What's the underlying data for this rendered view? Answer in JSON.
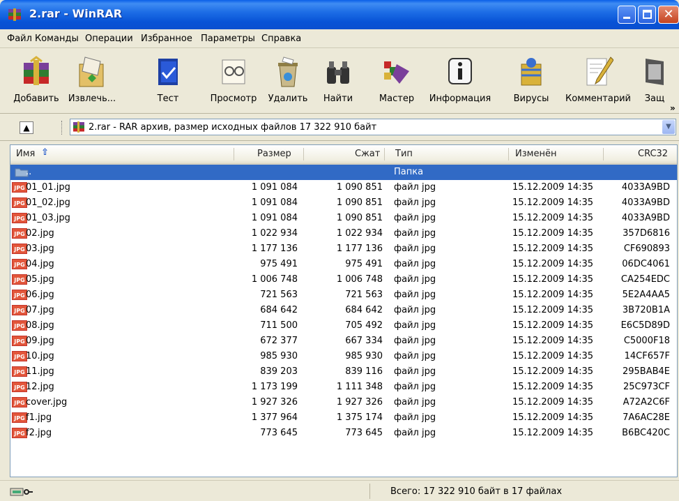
{
  "window": {
    "title": "2.rar - WinRAR"
  },
  "menu": [
    "Файл",
    "Команды",
    "Операции",
    "Избранное",
    "Параметры",
    "Справка"
  ],
  "toolbar": {
    "add": "Добавить",
    "extract": "Извлечь...",
    "test": "Тест",
    "view": "Просмотр",
    "delete": "Удалить",
    "find": "Найти",
    "wizard": "Мастер",
    "info": "Информация",
    "virus": "Вирусы",
    "comment": "Комментарий",
    "protect": "Защ"
  },
  "address": {
    "path": "2.rar - RAR архив, размер исходных файлов 17 322 910 байт"
  },
  "columns": {
    "name": "Имя",
    "size": "Размер",
    "packed": "Сжат",
    "type": "Тип",
    "modified": "Изменён",
    "crc": "CRC32"
  },
  "parent_row": {
    "name": "..",
    "type": "Папка"
  },
  "files": [
    {
      "name": "01_01.jpg",
      "size": "1 091 084",
      "packed": "1 090 851",
      "type": "файл jpg",
      "modified": "15.12.2009 14:35",
      "crc": "4033A9BD"
    },
    {
      "name": "01_02.jpg",
      "size": "1 091 084",
      "packed": "1 090 851",
      "type": "файл jpg",
      "modified": "15.12.2009 14:35",
      "crc": "4033A9BD"
    },
    {
      "name": "01_03.jpg",
      "size": "1 091 084",
      "packed": "1 090 851",
      "type": "файл jpg",
      "modified": "15.12.2009 14:35",
      "crc": "4033A9BD"
    },
    {
      "name": "02.jpg",
      "size": "1 022 934",
      "packed": "1 022 934",
      "type": "файл jpg",
      "modified": "15.12.2009 14:35",
      "crc": "357D6816"
    },
    {
      "name": "03.jpg",
      "size": "1 177 136",
      "packed": "1 177 136",
      "type": "файл jpg",
      "modified": "15.12.2009 14:35",
      "crc": "CF690893"
    },
    {
      "name": "04.jpg",
      "size": "975 491",
      "packed": "975 491",
      "type": "файл jpg",
      "modified": "15.12.2009 14:35",
      "crc": "06DC4061"
    },
    {
      "name": "05.jpg",
      "size": "1 006 748",
      "packed": "1 006 748",
      "type": "файл jpg",
      "modified": "15.12.2009 14:35",
      "crc": "CA254EDC"
    },
    {
      "name": "06.jpg",
      "size": "721 563",
      "packed": "721 563",
      "type": "файл jpg",
      "modified": "15.12.2009 14:35",
      "crc": "5E2A4AA5"
    },
    {
      "name": "07.jpg",
      "size": "684 642",
      "packed": "684 642",
      "type": "файл jpg",
      "modified": "15.12.2009 14:35",
      "crc": "3B720B1A"
    },
    {
      "name": "08.jpg",
      "size": "711 500",
      "packed": "705 492",
      "type": "файл jpg",
      "modified": "15.12.2009 14:35",
      "crc": "E6C5D89D"
    },
    {
      "name": "09.jpg",
      "size": "672 377",
      "packed": "667 334",
      "type": "файл jpg",
      "modified": "15.12.2009 14:35",
      "crc": "C5000F18"
    },
    {
      "name": "10.jpg",
      "size": "985 930",
      "packed": "985 930",
      "type": "файл jpg",
      "modified": "15.12.2009 14:35",
      "crc": "14CF657F"
    },
    {
      "name": "11.jpg",
      "size": "839 203",
      "packed": "839 116",
      "type": "файл jpg",
      "modified": "15.12.2009 14:35",
      "crc": "295BAB4E"
    },
    {
      "name": "12.jpg",
      "size": "1 173 199",
      "packed": "1 111 348",
      "type": "файл jpg",
      "modified": "15.12.2009 14:35",
      "crc": "25C973CF"
    },
    {
      "name": "cover.jpg",
      "size": "1 927 326",
      "packed": "1 927 326",
      "type": "файл jpg",
      "modified": "15.12.2009 14:35",
      "crc": "A72A2C6F"
    },
    {
      "name": "f1.jpg",
      "size": "1 377 964",
      "packed": "1 375 174",
      "type": "файл jpg",
      "modified": "15.12.2009 14:35",
      "crc": "7A6AC28E"
    },
    {
      "name": "f2.jpg",
      "size": "773 645",
      "packed": "773 645",
      "type": "файл jpg",
      "modified": "15.12.2009 14:35",
      "crc": "B6BC420C"
    }
  ],
  "status": {
    "summary": "Всего: 17 322 910 байт в 17 файлах"
  },
  "colors": {
    "titlebar": "#0a5fe8",
    "selection": "#316ac5",
    "chrome": "#ece9d8"
  }
}
